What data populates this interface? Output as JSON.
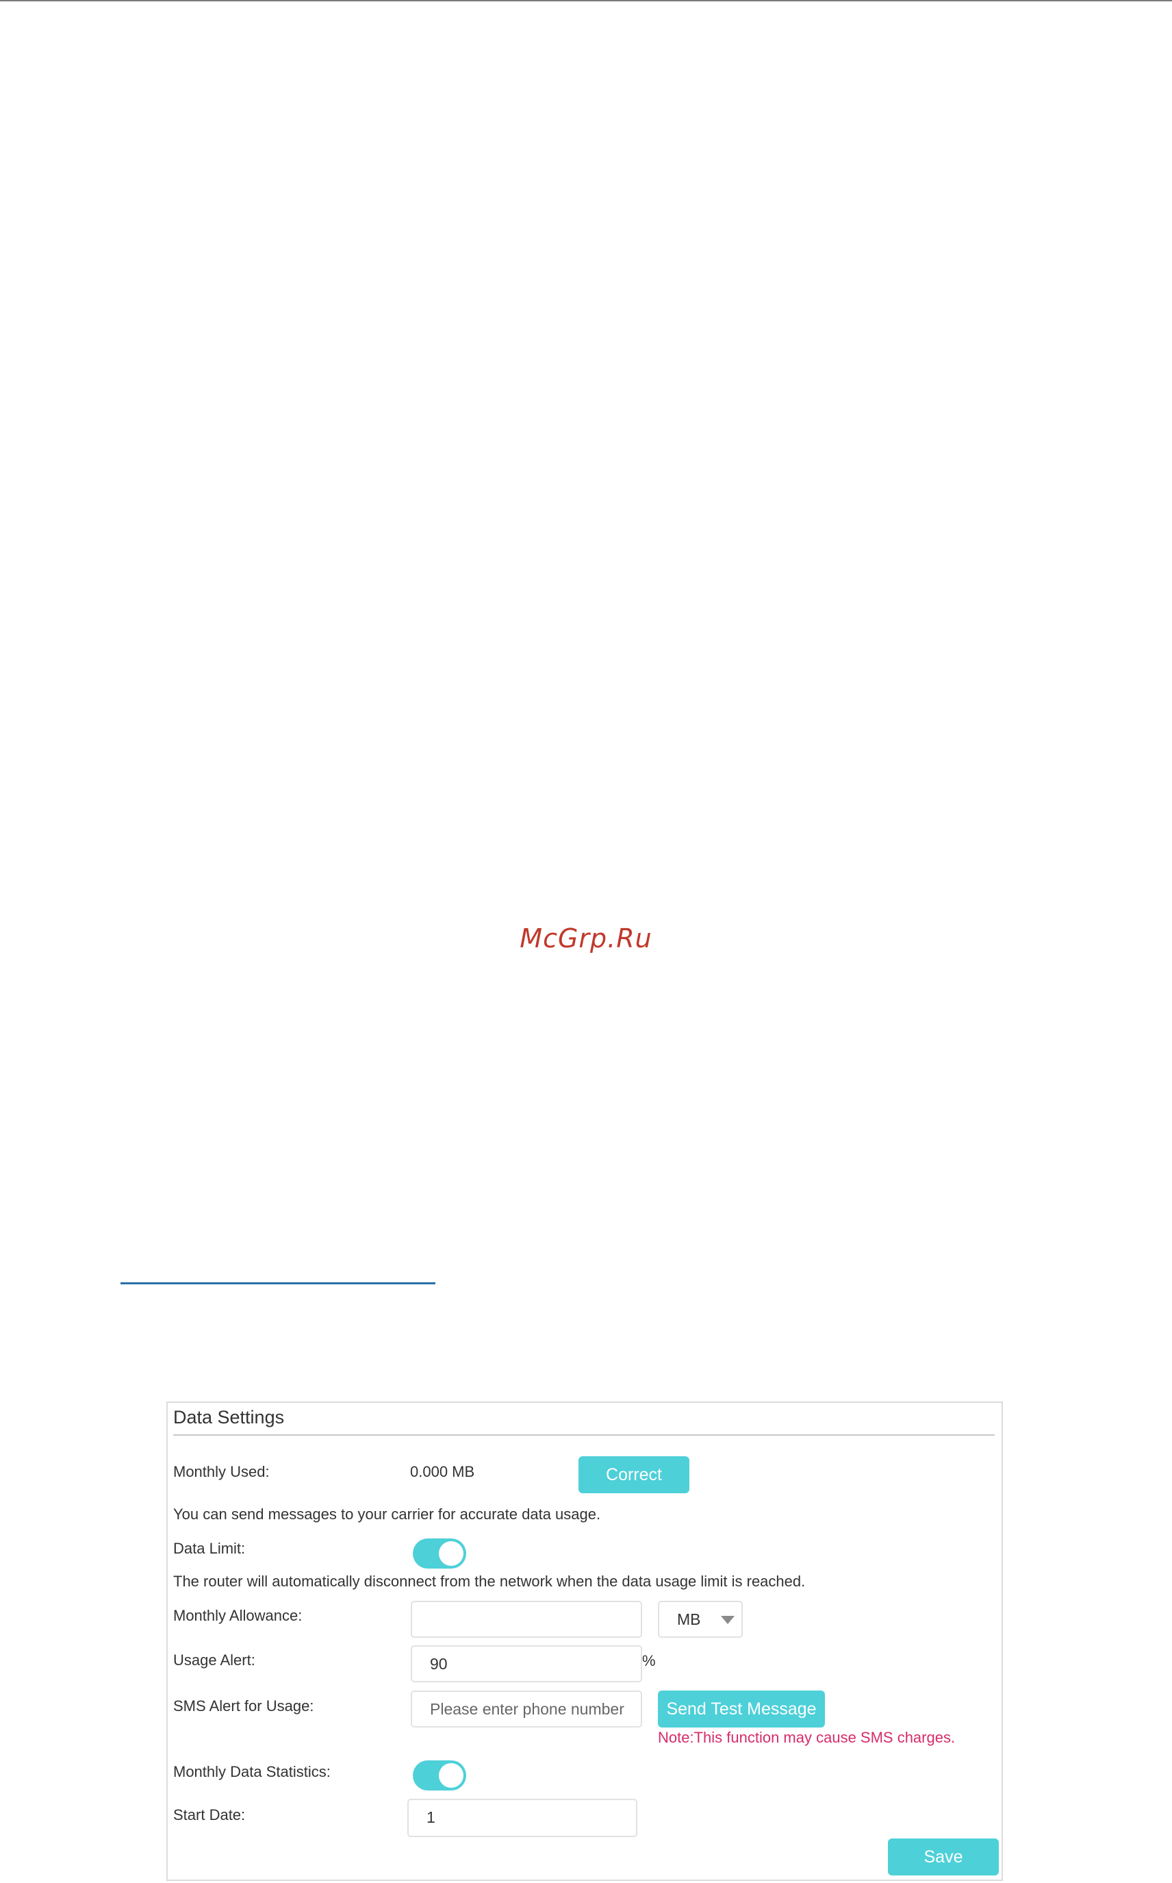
{
  "watermark": "McGrp.Ru",
  "panel": {
    "title": "Data Settings",
    "monthly_used": {
      "label": "Monthly Used:",
      "value": "0.000 MB",
      "button": "Correct"
    },
    "carrier_hint": "You can send messages to your carrier for accurate data usage.",
    "data_limit": {
      "label": "Data Limit:",
      "enabled": true
    },
    "disconnect_hint": "The router will automatically disconnect from the network when the data usage limit is reached.",
    "monthly_allowance": {
      "label": "Monthly Allowance:",
      "value": "",
      "unit": "MB"
    },
    "usage_alert": {
      "label": "Usage Alert:",
      "value": "90",
      "suffix": "%"
    },
    "sms_alert": {
      "label": "SMS Alert for Usage:",
      "placeholder": "Please enter phone number",
      "button": "Send Test Message",
      "note": "Note:This function may cause SMS charges."
    },
    "monthly_stats": {
      "label": "Monthly Data Statistics:",
      "enabled": true
    },
    "start_date": {
      "label": "Start Date:",
      "value": "1"
    },
    "save": "Save"
  },
  "colors": {
    "accent": "#4dd0d8",
    "note": "#d62c6a",
    "watermark": "#c0392b",
    "link_rule": "#2b6fa8"
  }
}
